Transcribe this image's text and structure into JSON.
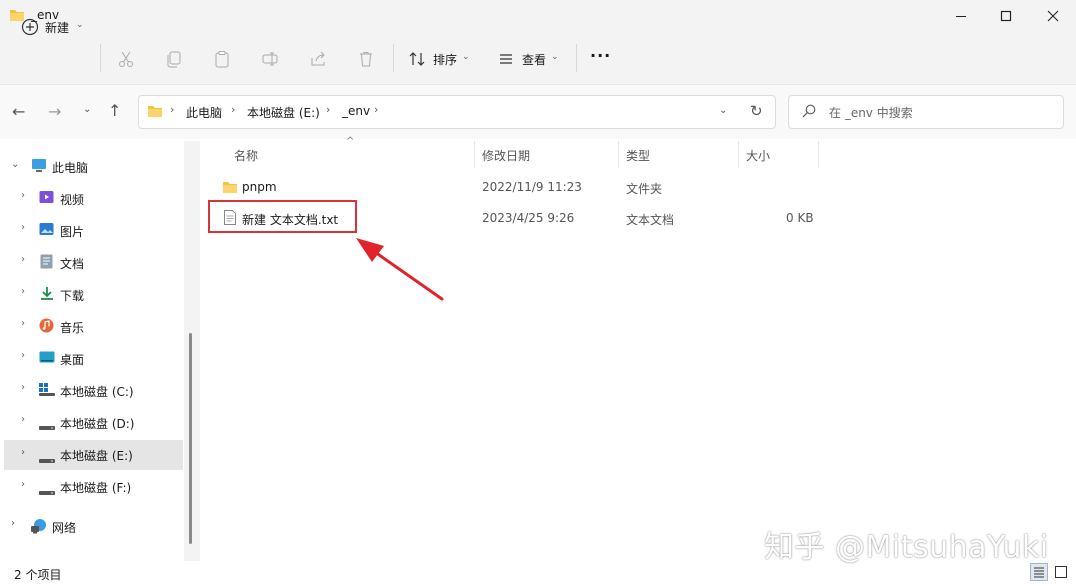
{
  "window": {
    "title": "_env",
    "colors": {
      "titlebar": "#f3f3f3",
      "selection": "#e5e5e5",
      "accent": "#0067c0",
      "highlight_box": "#d9333a",
      "arrow": "#e1232b"
    }
  },
  "toolbar": {
    "new_label": "新建",
    "sort_label": "排序",
    "view_label": "查看",
    "more_label": "···"
  },
  "address": {
    "crumbs": [
      "此电脑",
      "本地磁盘 (E:)",
      "_env"
    ],
    "search_placeholder": "在 _env 中搜索"
  },
  "nav": {
    "items": [
      {
        "label": "此电脑",
        "icon": "pc-icon"
      },
      {
        "label": "视频",
        "icon": "video-icon"
      },
      {
        "label": "图片",
        "icon": "picture-icon"
      },
      {
        "label": "文档",
        "icon": "document-icon"
      },
      {
        "label": "下载",
        "icon": "download-icon"
      },
      {
        "label": "音乐",
        "icon": "music-icon"
      },
      {
        "label": "桌面",
        "icon": "desktop-icon"
      },
      {
        "label": "本地磁盘 (C:)",
        "icon": "windows-drive-icon"
      },
      {
        "label": "本地磁盘 (D:)",
        "icon": "drive-icon"
      },
      {
        "label": "本地磁盘 (E:)",
        "icon": "drive-icon",
        "selected": true
      },
      {
        "label": "本地磁盘 (F:)",
        "icon": "drive-icon"
      },
      {
        "label": "网络",
        "icon": "network-icon"
      }
    ]
  },
  "columns": {
    "name": "名称",
    "modified": "修改日期",
    "type": "类型",
    "size": "大小"
  },
  "files": [
    {
      "name": "pnpm",
      "modified": "2022/11/9 11:23",
      "type": "文件夹",
      "size": ""
    },
    {
      "name": "新建 文本文档.txt",
      "modified": "2023/4/25 9:26",
      "type": "文本文档",
      "size": "0 KB"
    }
  ],
  "status": {
    "count": "2 个项目"
  },
  "watermark": "知乎 @MitsuhaYuki"
}
